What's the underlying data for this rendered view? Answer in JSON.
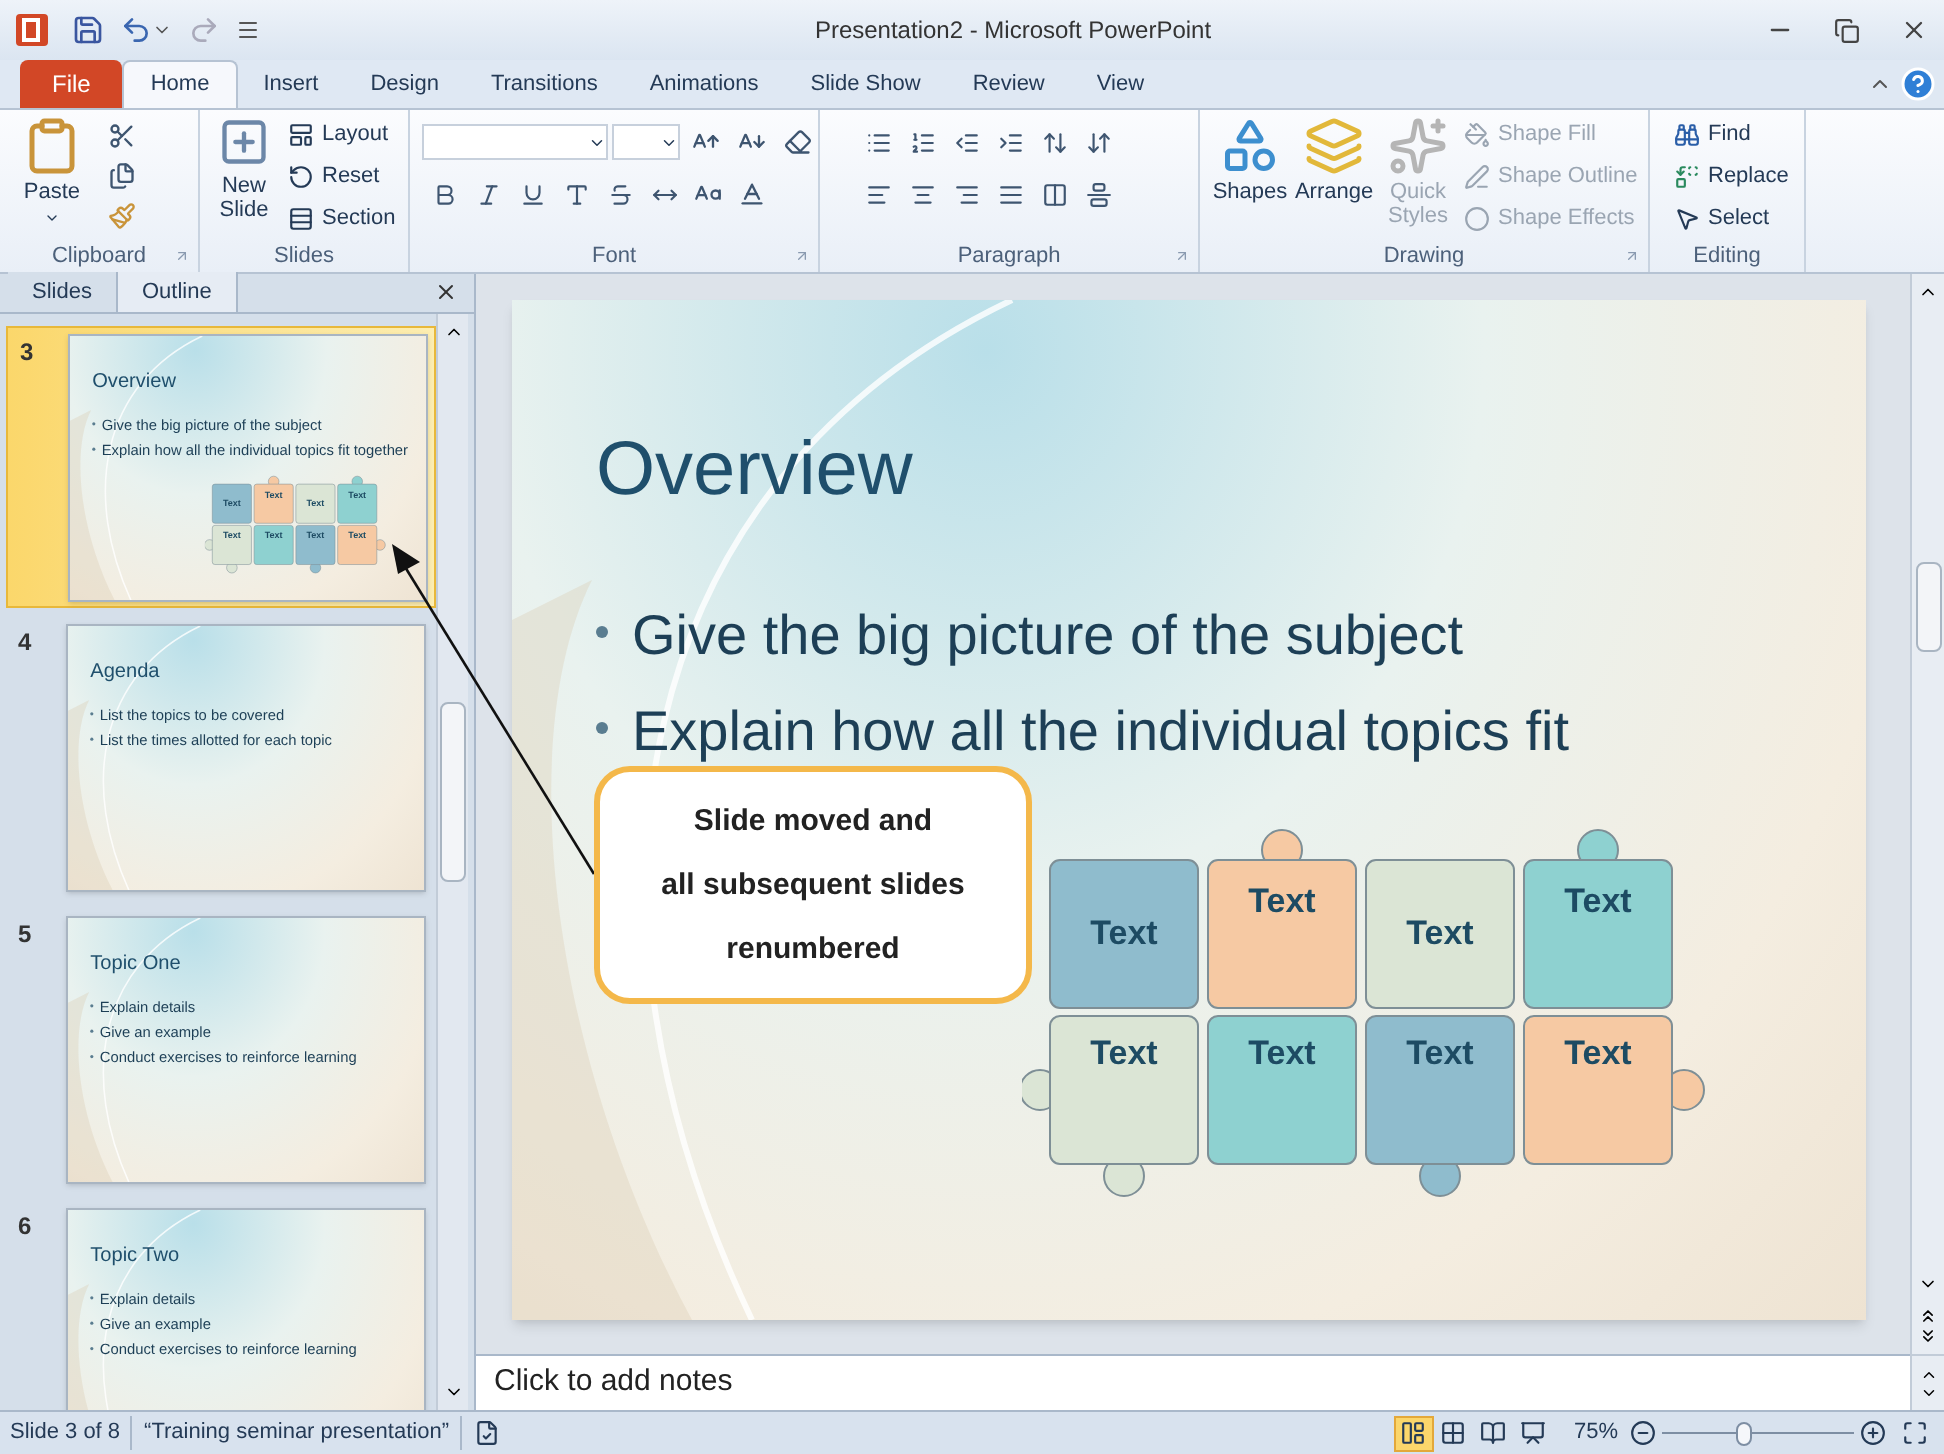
{
  "window": {
    "title": "Presentation2 - Microsoft PowerPoint"
  },
  "ribbon_tabs": [
    {
      "label": "File",
      "kind": "file",
      "selected": false
    },
    {
      "label": "Home",
      "kind": "tab",
      "selected": true
    },
    {
      "label": "Insert",
      "kind": "tab",
      "selected": false
    },
    {
      "label": "Design",
      "kind": "tab",
      "selected": false
    },
    {
      "label": "Transitions",
      "kind": "tab",
      "selected": false
    },
    {
      "label": "Animations",
      "kind": "tab",
      "selected": false
    },
    {
      "label": "Slide Show",
      "kind": "tab",
      "selected": false
    },
    {
      "label": "Review",
      "kind": "tab",
      "selected": false
    },
    {
      "label": "View",
      "kind": "tab",
      "selected": false
    }
  ],
  "ribbon": {
    "clipboard": {
      "label": "Clipboard",
      "paste": "Paste"
    },
    "slides": {
      "label": "Slides",
      "new_slide": "New Slide",
      "layout": "Layout",
      "reset": "Reset",
      "section": "Section"
    },
    "font": {
      "label": "Font"
    },
    "paragraph": {
      "label": "Paragraph"
    },
    "drawing": {
      "label": "Drawing",
      "items": [
        {
          "label": "Shapes",
          "kind": "large",
          "disabled": false
        },
        {
          "label": "Arrange",
          "kind": "large",
          "disabled": false
        },
        {
          "label": "Quick Styles",
          "kind": "large",
          "disabled": true
        },
        {
          "label": "Shape Fill",
          "kind": "small",
          "disabled": true
        },
        {
          "label": "Shape Outline",
          "kind": "small",
          "disabled": true
        },
        {
          "label": "Shape Effects",
          "kind": "small",
          "disabled": true
        }
      ]
    },
    "editing": {
      "label": "Editing",
      "find": "Find",
      "replace": "Replace",
      "select": "Select"
    }
  },
  "panel_tabs": [
    {
      "label": "Slides",
      "selected": true
    },
    {
      "label": "Outline",
      "selected": false
    }
  ],
  "thumbnails": [
    {
      "number": "3",
      "selected": true,
      "title": "Overview",
      "bullets": [
        "Give the big picture of the subject",
        "Explain how all the individual topics fit together"
      ],
      "puzzle": [
        {
          "label": "Text",
          "color": "#8fbccd"
        },
        {
          "label": "Text",
          "color": "#f6c9a3"
        },
        {
          "label": "Text",
          "color": "#dbe5d5"
        },
        {
          "label": "Text",
          "color": "#8ed1d0"
        },
        {
          "label": "Text",
          "color": "#dbe5d5"
        },
        {
          "label": "Text",
          "color": "#8ed1d0"
        },
        {
          "label": "Text",
          "color": "#8fbccd"
        },
        {
          "label": "Text",
          "color": "#f6c9a3"
        }
      ]
    },
    {
      "number": "4",
      "selected": false,
      "title": "Agenda",
      "bullets": [
        "List the topics to be covered",
        "List the times allotted for each topic"
      ]
    },
    {
      "number": "5",
      "selected": false,
      "title": "Topic One",
      "bullets": [
        "Explain details",
        "Give an example",
        "Conduct exercises to reinforce learning"
      ]
    },
    {
      "number": "6",
      "selected": false,
      "title": "Topic Two",
      "bullets": [
        "Explain details",
        "Give an example",
        "Conduct exercises to reinforce learning"
      ]
    }
  ],
  "slide": {
    "title": "Overview",
    "bullets": [
      "Give the big picture of the subject",
      "Explain how all the individual topics fit"
    ],
    "puzzle": [
      {
        "label": "Text",
        "color": "#8fbccd"
      },
      {
        "label": "Text",
        "color": "#f6c9a3"
      },
      {
        "label": "Text",
        "color": "#dbe5d5"
      },
      {
        "label": "Text",
        "color": "#8ed1d0"
      },
      {
        "label": "Text",
        "color": "#dbe5d5"
      },
      {
        "label": "Text",
        "color": "#8ed1d0"
      },
      {
        "label": "Text",
        "color": "#8fbccd"
      },
      {
        "label": "Text",
        "color": "#f6c9a3"
      }
    ]
  },
  "callout": {
    "text": "Slide moved and\nall subsequent slides\nrenumbered"
  },
  "notes": {
    "placeholder": "Click to add notes"
  },
  "status_bar": {
    "slide": "Slide 3 of 8",
    "theme": "“Training seminar presentation”",
    "views": [
      {
        "kind": "normal",
        "selected": true
      },
      {
        "kind": "sorter",
        "selected": false
      },
      {
        "kind": "reading",
        "selected": false
      },
      {
        "kind": "slideshow",
        "selected": false
      }
    ],
    "zoom": "75%",
    "zoom_level": {
      "level": 0.43
    }
  }
}
